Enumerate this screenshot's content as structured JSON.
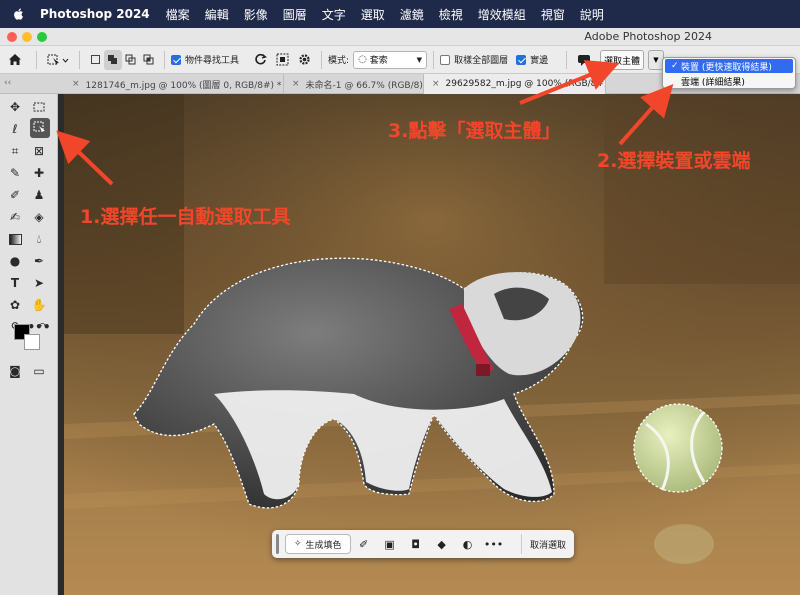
{
  "menubar": {
    "app_name": "Photoshop 2024",
    "items": [
      "檔案",
      "編輯",
      "影像",
      "圖層",
      "文字",
      "選取",
      "濾鏡",
      "檢視",
      "增效模組",
      "視窗",
      "說明"
    ]
  },
  "window": {
    "title": "Adobe Photoshop 2024"
  },
  "options": {
    "object_finder": "物件尋找工具",
    "mode_label": "模式:",
    "mode_value": "套索",
    "sample_all_layers": "取樣全部圖層",
    "hard_edge": "實邊",
    "select_subject": "選取主體"
  },
  "popup": {
    "items": [
      {
        "label": "裝置 (更快速取得結果)",
        "checked": true
      },
      {
        "label": "雲端 (詳細結果)",
        "checked": false
      }
    ]
  },
  "tabs": [
    {
      "label": "1281746_m.jpg @ 100% (圖層 0, RGB/8#) *"
    },
    {
      "label": "未命名-1 @ 66.7% (RGB/8)"
    },
    {
      "label": "29629582_m.jpg @ 100% (RGB/8#)"
    }
  ],
  "taskbar": {
    "generate_fill": "生成填色",
    "cancel_selection": "取消選取"
  },
  "annotations": {
    "step1": "1.選擇任一自動選取工具",
    "step2": "2.選擇裝置或雲端",
    "step3": "3.點擊「選取主體」"
  },
  "colors": {
    "annotation": "#f2462a",
    "menubar": "#1f2a4a",
    "popup_highlight": "#2f6cf0",
    "collar": "#c0263e"
  },
  "icons": {
    "apple": "apple-icon",
    "home": "home-icon",
    "refresh": "refresh-icon",
    "settings": "gear-icon"
  }
}
